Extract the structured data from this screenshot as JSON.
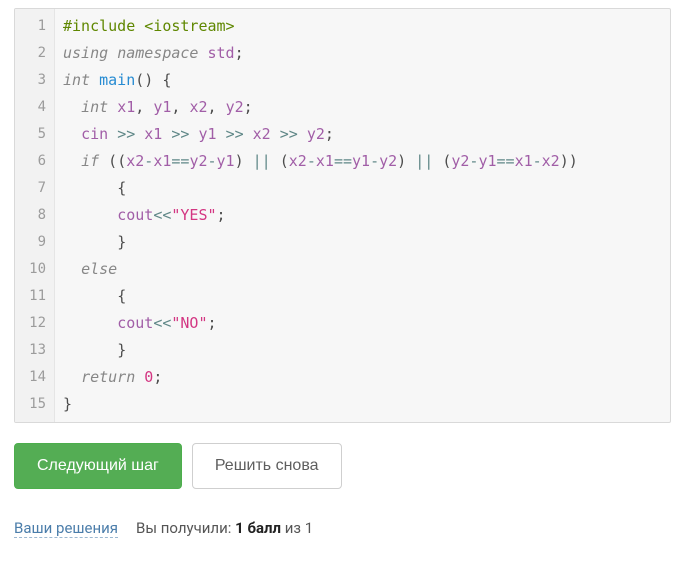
{
  "code": {
    "language": "cpp",
    "lines": [
      "#include <iostream>",
      "using namespace std;",
      "int main() {",
      "  int x1, y1, x2, y2;",
      "  cin >> x1 >> y1 >> x2 >> y2;",
      "  if ((x2-x1==y2-y1) || (x2-x1==y1-y2) || (y2-y1==x1-x2))",
      "      {",
      "      cout<<\"YES\";",
      "      }",
      "  else",
      "      {",
      "      cout<<\"NO\";",
      "      }",
      "  return 0;",
      "}"
    ]
  },
  "buttons": {
    "next_label": "Следующий шаг",
    "retry_label": "Решить снова"
  },
  "footer": {
    "link_label": "Ваши решения",
    "score_prefix": "Вы получили: ",
    "score_bold": "1 балл",
    "score_suffix": " из 1"
  }
}
